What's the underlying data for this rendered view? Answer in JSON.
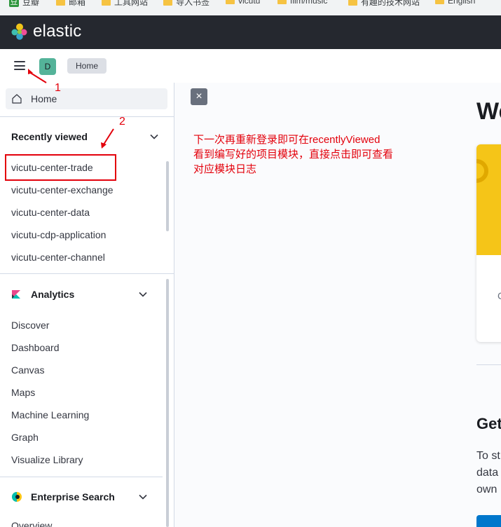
{
  "bookmarks": [
    {
      "label": "豆瓣",
      "icon": "douban-icon"
    },
    {
      "label": "邮箱",
      "icon": "folder-icon"
    },
    {
      "label": "工具网站",
      "icon": "folder-icon"
    },
    {
      "label": "导入书签",
      "icon": "folder-icon"
    },
    {
      "label": "vicutu",
      "icon": "folder-icon"
    },
    {
      "label": "film/music",
      "icon": "folder-icon"
    },
    {
      "label": "有趣的技术网站",
      "icon": "folder-icon"
    },
    {
      "label": "English",
      "icon": "folder-icon"
    }
  ],
  "header": {
    "brand": "elastic"
  },
  "toolbar": {
    "avatar_initial": "D",
    "breadcrumb": "Home"
  },
  "sidebar": {
    "home_label": "Home",
    "recently_viewed": {
      "title": "Recently viewed",
      "items": [
        "vicutu-center-trade",
        "vicutu-center-exchange",
        "vicutu-center-data",
        "vicutu-cdp-application",
        "vicutu-center-channel"
      ]
    },
    "analytics": {
      "title": "Analytics",
      "items": [
        "Discover",
        "Dashboard",
        "Canvas",
        "Maps",
        "Machine Learning",
        "Graph",
        "Visualize Library"
      ]
    },
    "enterprise_search": {
      "title": "Enterprise Search",
      "items": [
        "Overview"
      ]
    }
  },
  "main": {
    "close_glyph": "×",
    "welcome_fragment": "We",
    "card_char": "C",
    "get_fragment": "Get",
    "get_lines": [
      "To st",
      "data",
      "own"
    ]
  },
  "annotation": {
    "note_line1": "下一次再重新登录即可在recentlyViewed",
    "note_line2": "看到编写好的项目模块，直接点击即可查看",
    "note_line3": "对应模块日志",
    "num1": "1",
    "num2": "2",
    "color": "#e3000b"
  }
}
